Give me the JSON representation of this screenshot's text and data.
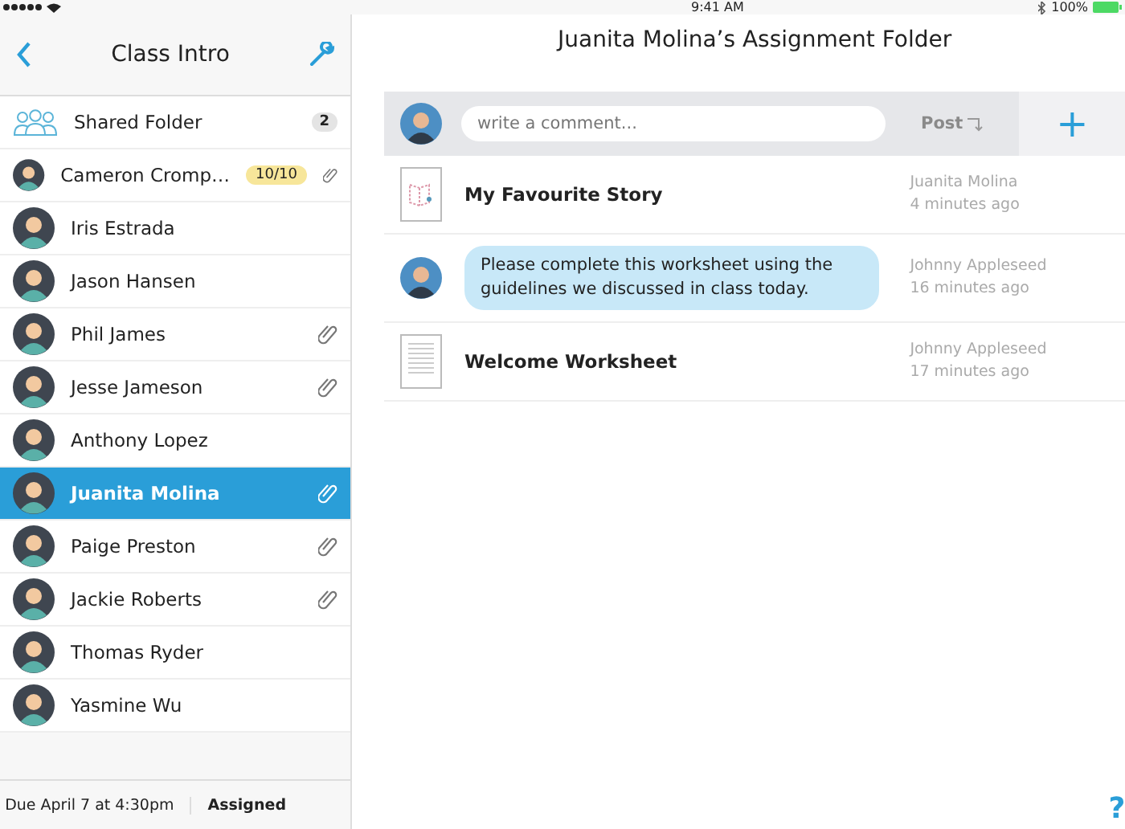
{
  "status_bar": {
    "time": "9:41 AM",
    "battery": "100%"
  },
  "sidebar": {
    "title": "Class Intro",
    "shared_folder": {
      "label": "Shared Folder",
      "count": "2"
    },
    "students": [
      {
        "name": "Cameron Cromp…",
        "badge": "10/10",
        "attachment": true,
        "selected": false
      },
      {
        "name": "Iris Estrada",
        "attachment": false,
        "selected": false
      },
      {
        "name": "Jason Hansen",
        "attachment": false,
        "selected": false
      },
      {
        "name": "Phil James",
        "attachment": true,
        "selected": false
      },
      {
        "name": "Jesse Jameson",
        "attachment": true,
        "selected": false
      },
      {
        "name": "Anthony Lopez",
        "attachment": false,
        "selected": false
      },
      {
        "name": "Juanita Molina",
        "attachment": true,
        "selected": true
      },
      {
        "name": "Paige Preston",
        "attachment": true,
        "selected": false
      },
      {
        "name": "Jackie Roberts",
        "attachment": true,
        "selected": false
      },
      {
        "name": "Thomas Ryder",
        "attachment": false,
        "selected": false
      },
      {
        "name": "Yasmine Wu",
        "attachment": false,
        "selected": false
      }
    ],
    "footer": {
      "due": "Due April 7 at 4:30pm",
      "status": "Assigned"
    }
  },
  "main": {
    "title": "Juanita Molina’s Assignment Folder",
    "comment": {
      "placeholder": "write a comment...",
      "post": "Post",
      "add": "+"
    },
    "items": [
      {
        "kind": "story",
        "title": "My Favourite Story",
        "author": "Juanita Molina",
        "time": "4 minutes ago"
      },
      {
        "kind": "comment",
        "text": "Please complete this worksheet using the guidelines we discussed in class today.",
        "author": "Johnny Appleseed",
        "time": "16 minutes ago"
      },
      {
        "kind": "worksheet",
        "title": "Welcome Worksheet",
        "author": "Johnny Appleseed",
        "time": "17 minutes ago"
      }
    ],
    "help": "?"
  }
}
